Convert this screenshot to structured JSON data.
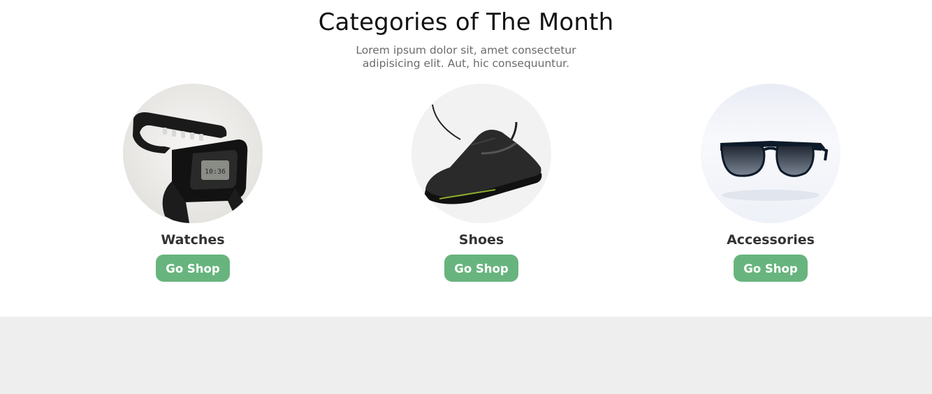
{
  "section": {
    "title": "Categories of The Month",
    "subtitle": "Lorem ipsum dolor sit, amet consectetur adipisicing elit. Aut, hic consequuntur."
  },
  "categories": [
    {
      "name": "Watches",
      "button": "Go Shop",
      "icon": "watch-image"
    },
    {
      "name": "Shoes",
      "button": "Go Shop",
      "icon": "sneaker-image"
    },
    {
      "name": "Accessories",
      "button": "Go Shop",
      "icon": "sunglasses-image"
    }
  ],
  "colors": {
    "button": "#68b47e",
    "footer_band": "#eeeeee",
    "heading": "#111111",
    "muted": "#6b6b6b"
  }
}
